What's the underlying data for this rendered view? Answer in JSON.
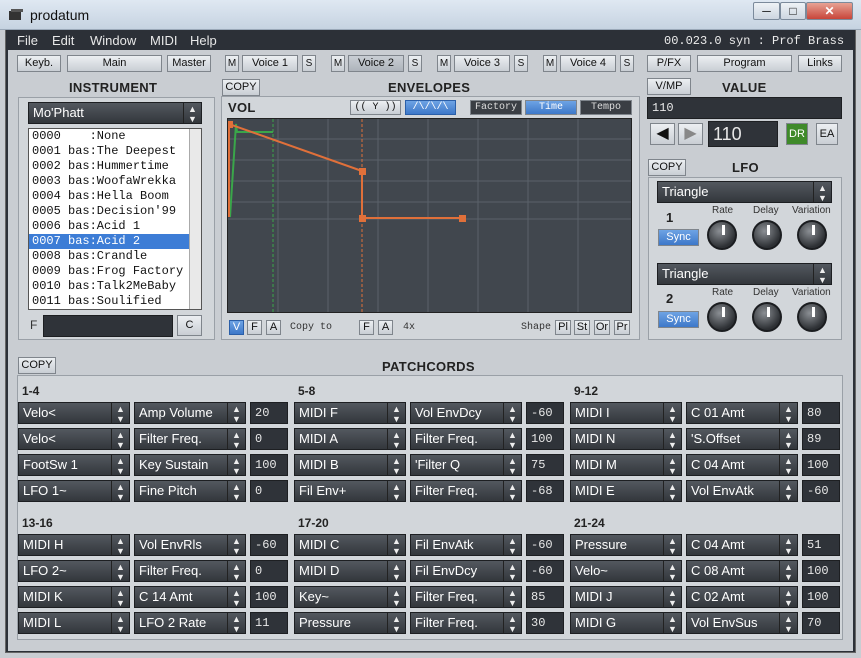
{
  "window": {
    "title": "prodatum",
    "min": "─",
    "max": "□",
    "close": "✕"
  },
  "menu": [
    "File",
    "Edit",
    "Window",
    "MIDI",
    "Help"
  ],
  "status": "00.023.0 syn : Prof Brass",
  "toolbar": {
    "keyb": "Keyb.",
    "main": "Main",
    "master": "Master",
    "voices": [
      {
        "m": "M",
        "label": "Voice 1",
        "s": "S"
      },
      {
        "m": "M",
        "label": "Voice 2",
        "s": "S"
      },
      {
        "m": "M",
        "label": "Voice 3",
        "s": "S"
      },
      {
        "m": "M",
        "label": "Voice 4",
        "s": "S"
      }
    ],
    "pfx": "P/FX",
    "program": "Program",
    "links": "Links"
  },
  "instrument": {
    "title": "INSTRUMENT",
    "selected": "Mo'Phatt",
    "items": [
      "0000    :None",
      "0001 bas:The Deepest",
      "0002 bas:Hummertime",
      "0003 bas:WoofaWrekka",
      "0004 bas:Hella Boom",
      "0005 bas:Decision'99",
      "0006 bas:Acid 1",
      "0007 bas:Acid 2",
      "0008 bas:Crandle",
      "0009 bas:Frog Factory",
      "0010 bas:Talk2MeBaby",
      "0011 bas:Soulified"
    ],
    "selected_index": 7,
    "filter_label": "F",
    "filter_value": "",
    "clear": "C"
  },
  "envelopes": {
    "title": "ENVELOPES",
    "copy": "COPY",
    "env": "VOL",
    "btn_y": "(( Y ))",
    "btn_wave": "/\\/\\/\\",
    "factory": "Factory",
    "time": "Time",
    "tempo": "Tempo",
    "v": "V",
    "f": "F",
    "a": "A",
    "copyto": "Copy to",
    "f2": "F",
    "a2": "A",
    "zoom": "4x",
    "shape": "Shape",
    "pl": "Pl",
    "st": "St",
    "or": "Or",
    "pr": "Pr"
  },
  "value": {
    "vmp": "V/MP",
    "title": "VALUE",
    "field": "110",
    "display": "110",
    "dr": "DR",
    "ea": "EA"
  },
  "lfo": {
    "copy": "COPY",
    "title": "LFO",
    "rate": "Rate",
    "delay": "Delay",
    "variation": "Variation",
    "sync": "Sync",
    "units": [
      {
        "num": "1",
        "shape": "Triangle"
      },
      {
        "num": "2",
        "shape": "Triangle"
      }
    ]
  },
  "patchcords": {
    "copy": "COPY",
    "title": "PATCHCORDS",
    "groups": [
      {
        "label": "1-4",
        "rows": [
          [
            "Velo<",
            "Amp Volume",
            "20"
          ],
          [
            "Velo<",
            "Filter Freq.",
            "0"
          ],
          [
            "FootSw 1",
            "Key Sustain",
            "100"
          ],
          [
            "LFO 1~",
            "Fine Pitch",
            "0"
          ]
        ]
      },
      {
        "label": "5-8",
        "rows": [
          [
            "MIDI F",
            "Vol EnvDcy",
            "-60"
          ],
          [
            "MIDI A",
            "Filter Freq.",
            "100"
          ],
          [
            "MIDI B",
            "'Filter Q",
            "75"
          ],
          [
            "Fil Env+",
            "Filter Freq.",
            "-68"
          ]
        ]
      },
      {
        "label": "9-12",
        "rows": [
          [
            "MIDI I",
            "C 01 Amt",
            "80"
          ],
          [
            "MIDI N",
            "'S.Offset",
            "89"
          ],
          [
            "MIDI M",
            "C 04 Amt",
            "100"
          ],
          [
            "MIDI E",
            "Vol EnvAtk",
            "-60"
          ]
        ]
      },
      {
        "label": "13-16",
        "rows": [
          [
            "MIDI H",
            "Vol EnvRls",
            "-60"
          ],
          [
            "LFO 2~",
            "Filter Freq.",
            "0"
          ],
          [
            "MIDI K",
            "C 14 Amt",
            "100"
          ],
          [
            "MIDI L",
            "LFO 2 Rate",
            "11"
          ]
        ]
      },
      {
        "label": "17-20",
        "rows": [
          [
            "MIDI C",
            "Fil EnvAtk",
            "-60"
          ],
          [
            "MIDI D",
            "Fil EnvDcy",
            "-60"
          ],
          [
            "Key~",
            "Filter Freq.",
            "85"
          ],
          [
            "Pressure",
            "Filter Freq.",
            "30"
          ]
        ]
      },
      {
        "label": "21-24",
        "rows": [
          [
            "Pressure",
            "C 04 Amt",
            "51"
          ],
          [
            "Velo~",
            "C 08 Amt",
            "100"
          ],
          [
            "MIDI J",
            "C 02 Amt",
            "100"
          ],
          [
            "MIDI G",
            "Vol EnvSus",
            "70"
          ]
        ]
      }
    ]
  }
}
